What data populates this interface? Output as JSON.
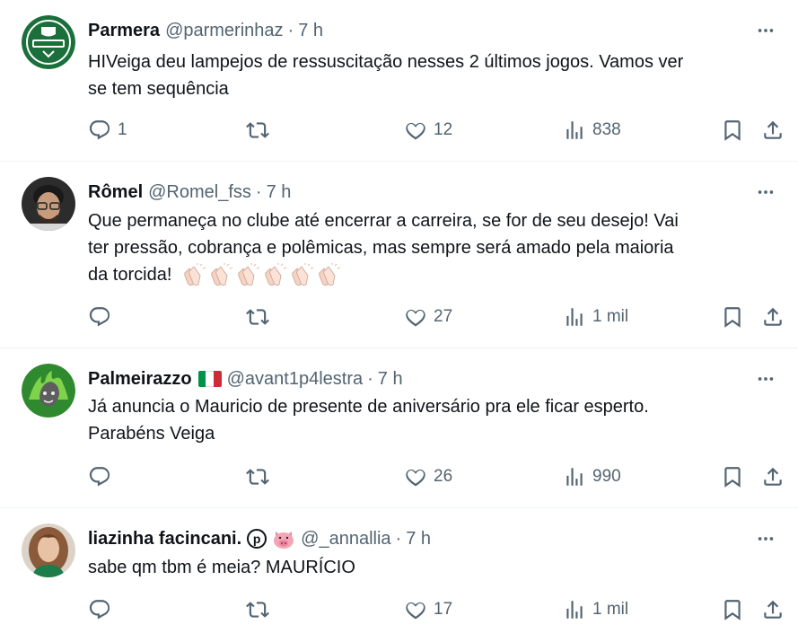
{
  "tweets": [
    {
      "name": "Parmera",
      "handle": "@parmerinhaz",
      "separator": "·",
      "time": "7 h",
      "lines": [
        "HIVeiga deu lampejos de ressuscitação nesses 2 últimos jogos. Vamos ver",
        "se tem sequência"
      ],
      "replies": "1",
      "retweets": "",
      "likes": "12",
      "views": "838"
    },
    {
      "name": "Rômel",
      "handle": "@Romel_fss",
      "separator": "·",
      "time": "7 h",
      "lines": [
        "Que permaneça no clube até encerrar a carreira, se for de seu desejo! Vai",
        "ter pressão, cobrança e polêmicas, mas sempre será amado pela maioria",
        "da torcida!"
      ],
      "replies": "",
      "retweets": "",
      "likes": "27",
      "views": "1 mil"
    },
    {
      "name": "Palmeirazzo",
      "handle": "@avant1p4lestra",
      "separator": "·",
      "time": "7 h",
      "lines": [
        "Já anuncia o Mauricio de presente de aniversário pra ele ficar esperto.",
        "Parabéns Veiga"
      ],
      "replies": "",
      "retweets": "",
      "likes": "26",
      "views": "990"
    },
    {
      "name": "liazinha facincani.",
      "badge": "p",
      "handle": "@_annallia",
      "separator": "·",
      "time": "7 h",
      "lines": [
        "sabe qm tbm é meia? MAURÍCIO"
      ],
      "replies": "",
      "retweets": "",
      "likes": "17",
      "views": "1 mil"
    }
  ],
  "colors": {
    "text": "#0f1419",
    "muted": "#536471",
    "divider": "#eff3f4",
    "palmeiras_green": "#1b6f3a"
  },
  "icons": [
    "reply-icon",
    "retweet-icon",
    "like-icon",
    "views-icon",
    "bookmark-icon",
    "share-icon",
    "more-icon"
  ]
}
